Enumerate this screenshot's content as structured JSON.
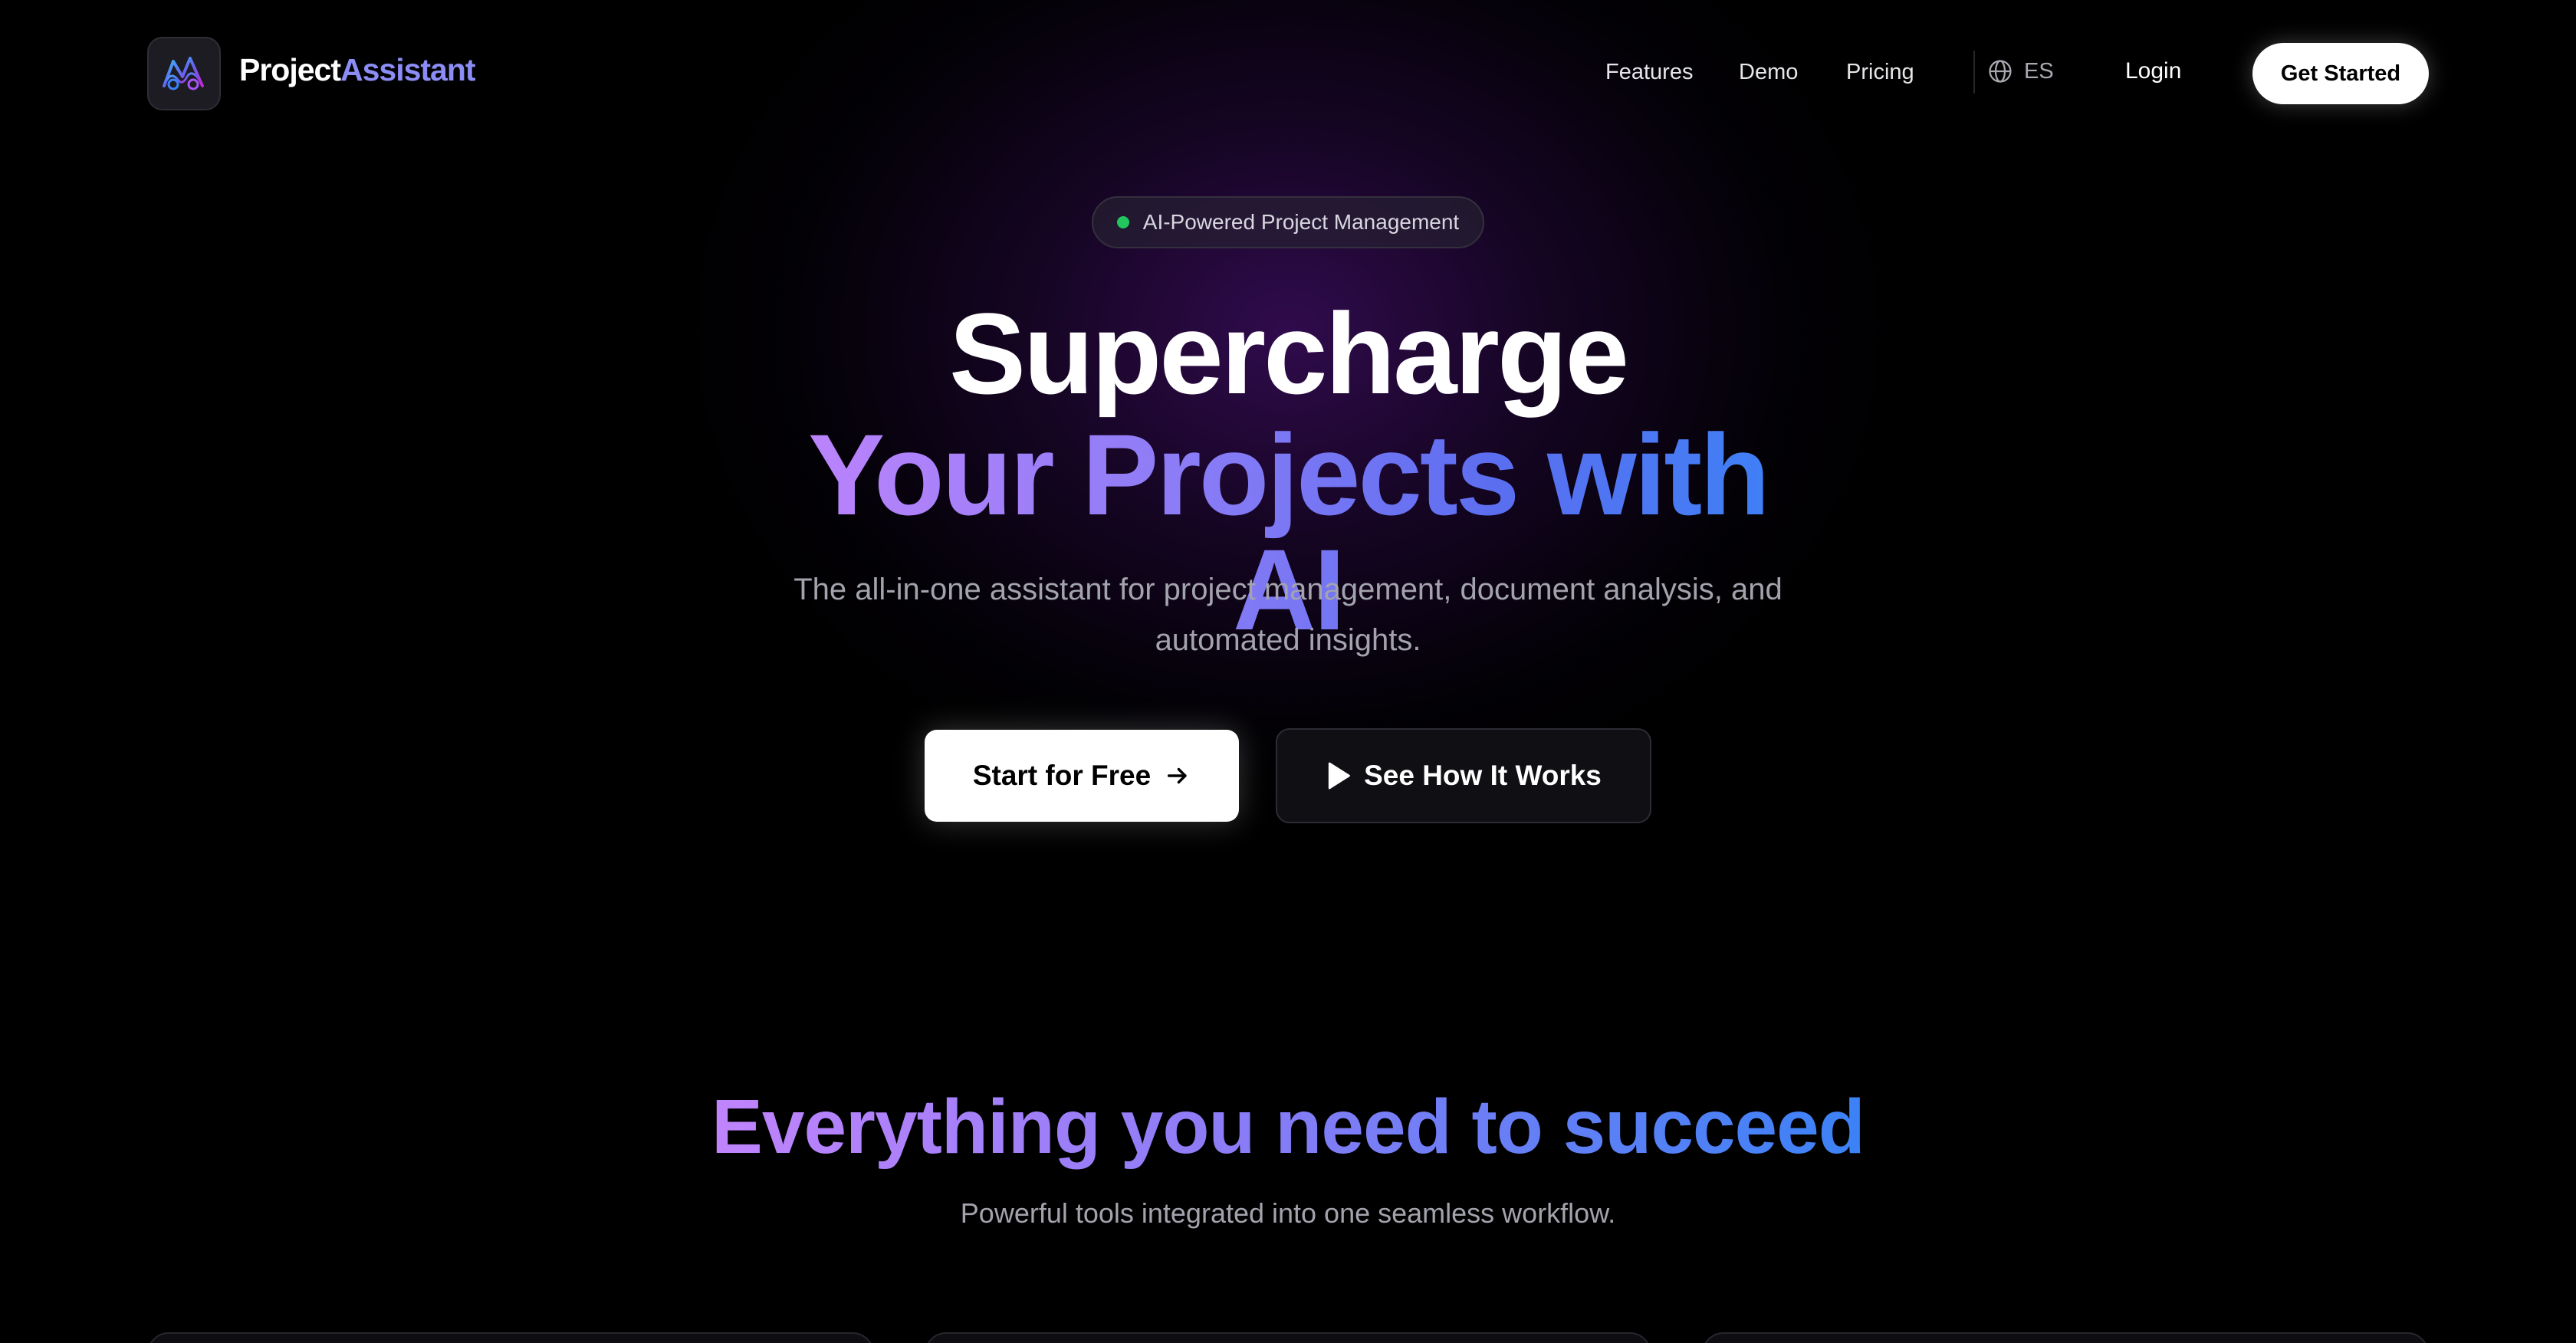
{
  "brand": {
    "part1": "Project",
    "part2": "Assistant"
  },
  "nav": {
    "links": [
      "Features",
      "Demo",
      "Pricing"
    ],
    "language": "ES",
    "login": "Login",
    "cta": "Get Started"
  },
  "hero": {
    "badge": "AI-Powered Project Management",
    "title_line1": "Supercharge",
    "title_line2": "Your Projects with AI",
    "subtitle": "The all-in-one assistant for project management, document analysis, and automated insights.",
    "primary_cta": "Start for Free",
    "secondary_cta": "See How It Works"
  },
  "features": {
    "title": "Everything you need to succeed",
    "subtitle": "Powerful tools integrated into one seamless workflow."
  },
  "colors": {
    "accent_purple": "#c084fc",
    "accent_blue": "#3b82f6",
    "status_green": "#22c55e",
    "background": "#000000"
  },
  "icons": {
    "logo": "logo-icon",
    "globe": "globe-icon",
    "arrow": "arrow-right-icon",
    "play": "play-icon"
  }
}
